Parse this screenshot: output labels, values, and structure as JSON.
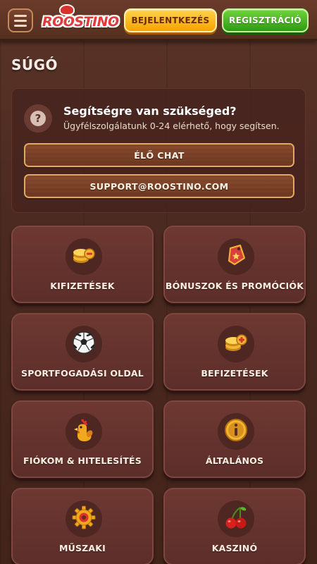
{
  "header": {
    "logo_text": "ROOSTINO",
    "login_label": "BEJELENTKEZÉS",
    "register_label": "REGISZTRÁCIÓ"
  },
  "page": {
    "title": "SÚGÓ"
  },
  "help": {
    "icon": "question-icon",
    "icon_glyph": "?",
    "heading": "Segítségre van szükséged?",
    "subtext": "Ügyfélszolgálatunk 0-24 elérhető, hogy segítsen.",
    "chat_label": "ÉLŐ CHAT",
    "email_label": "SUPPORT@ROOSTINO.COM"
  },
  "categories": [
    {
      "label": "KIFIZETÉSEK",
      "icon": "coins-withdraw-icon"
    },
    {
      "label": "BÓNUSZOK ÉS PROMÓCIÓK",
      "icon": "bonus-tag-icon"
    },
    {
      "label": "SPORTFOGADÁSI OLDAL",
      "icon": "soccer-ball-icon"
    },
    {
      "label": "BEFIZETÉSEK",
      "icon": "coins-deposit-icon"
    },
    {
      "label": "FIÓKOM & HITELESÍTÉS",
      "icon": "rooster-icon"
    },
    {
      "label": "ÁLTALÁNOS",
      "icon": "info-icon"
    },
    {
      "label": "MŰSZAKI",
      "icon": "gear-icon"
    },
    {
      "label": "KASZINÓ",
      "icon": "cherries-icon"
    }
  ],
  "colors": {
    "login_button": "#f6a300",
    "register_button": "#2f9a14",
    "card_background": "#6e3832",
    "wood_button_border": "#e0a962"
  }
}
